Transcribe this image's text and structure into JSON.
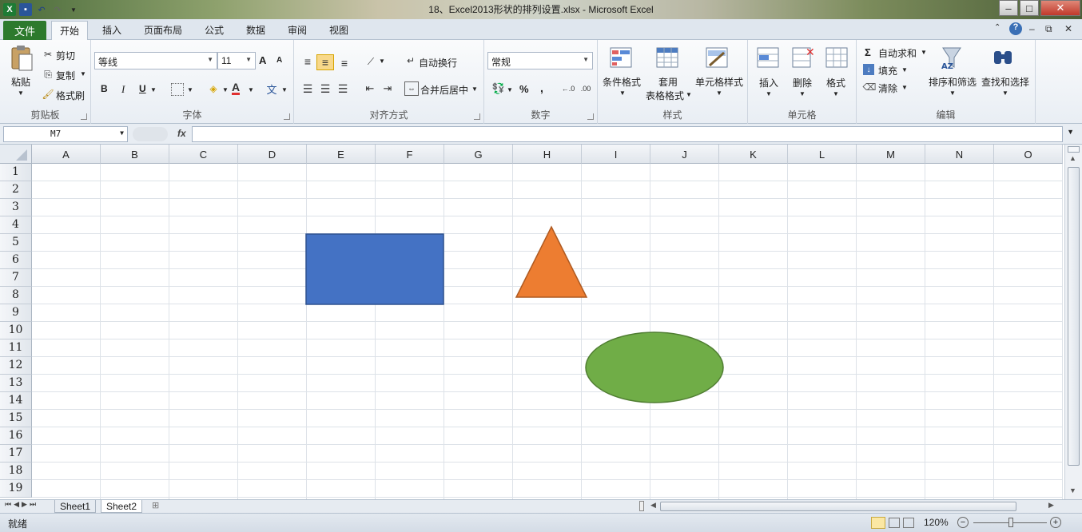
{
  "window": {
    "title": "18、Excel2013形状的排列设置.xlsx  -  Microsoft Excel"
  },
  "tabs": {
    "file": "文件",
    "items": [
      "开始",
      "插入",
      "页面布局",
      "公式",
      "数据",
      "审阅",
      "视图"
    ],
    "active": "开始"
  },
  "ribbon": {
    "clipboard": {
      "label": "剪贴板",
      "paste": "粘贴",
      "cut": "剪切",
      "copy": "复制",
      "format_painter": "格式刷"
    },
    "font": {
      "label": "字体",
      "font_name": "等线",
      "font_size": "11",
      "grow": "A",
      "shrink": "A",
      "bold": "B",
      "italic": "I",
      "underline": "U",
      "font_color": "A"
    },
    "alignment": {
      "label": "对齐方式",
      "wrap_text": "自动换行",
      "merge_center": "合并后居中"
    },
    "number": {
      "label": "数字",
      "format": "常规",
      "percent": "%",
      "comma": ","
    },
    "styles": {
      "label": "样式",
      "conditional": "条件格式",
      "table_format_1": "套用",
      "table_format_2": "表格格式",
      "cell_styles": "单元格样式"
    },
    "cells": {
      "label": "单元格",
      "insert": "插入",
      "delete": "删除",
      "format": "格式"
    },
    "editing": {
      "label": "编辑",
      "autosum": "自动求和",
      "fill": "填充",
      "clear": "清除",
      "sort_filter": "排序和筛选",
      "find_select": "查找和选择"
    }
  },
  "formula_bar": {
    "name_box": "M7",
    "fx": "fx",
    "content": ""
  },
  "grid": {
    "columns": [
      "A",
      "B",
      "C",
      "D",
      "E",
      "F",
      "G",
      "H",
      "I",
      "J",
      "K",
      "L",
      "M",
      "N",
      "O"
    ],
    "rows": [
      "1",
      "2",
      "3",
      "4",
      "5",
      "6",
      "7",
      "8",
      "9",
      "10",
      "11",
      "12",
      "13",
      "14",
      "15",
      "16",
      "17",
      "18",
      "19"
    ]
  },
  "shapes": {
    "rectangle_color": "#4472c4",
    "triangle_color": "#ed7d31",
    "ellipse_color": "#70ad47"
  },
  "sheets": {
    "tabs": [
      "Sheet1",
      "Sheet2"
    ],
    "active": "Sheet2"
  },
  "status": {
    "text": "就绪",
    "zoom": "120%"
  }
}
